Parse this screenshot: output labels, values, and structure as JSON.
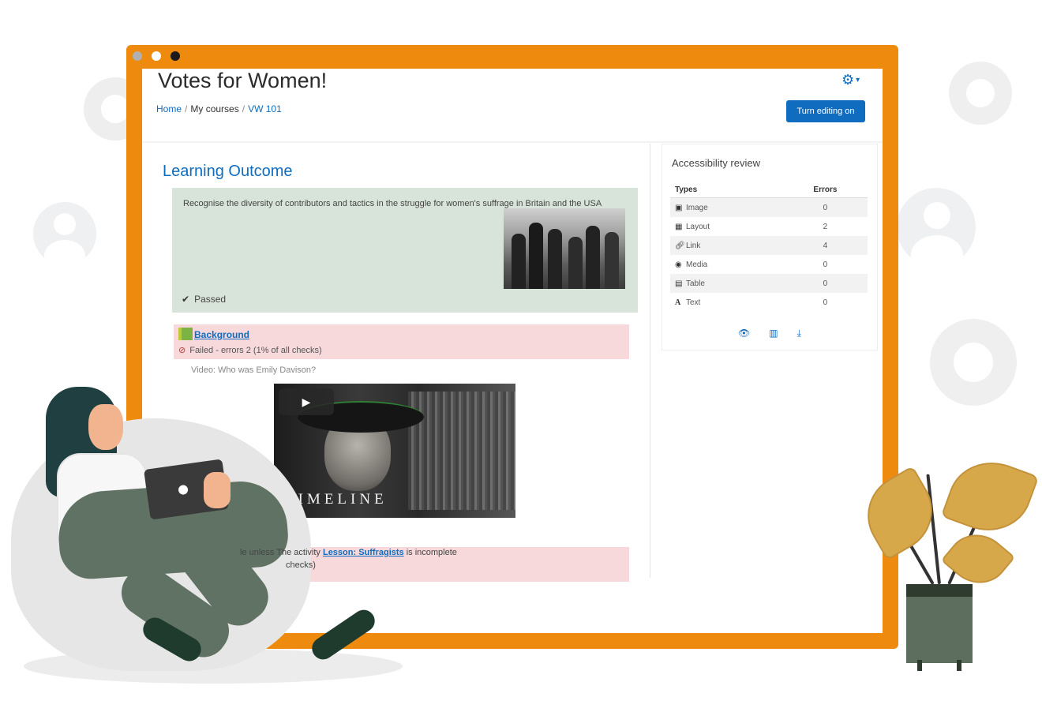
{
  "course": {
    "title": "Votes for Women!",
    "breadcrumb": [
      "Home",
      "My courses",
      "VW 101"
    ],
    "edit_button": "Turn editing on"
  },
  "learning_outcome": {
    "heading": "Learning Outcome",
    "description": "Recognise the diversity of contributors and tactics in the struggle for women's suffrage in Britain and the USA",
    "status": "Passed"
  },
  "activity": {
    "name": "Background",
    "status": "Failed - errors 2 (1% of all checks)",
    "video_caption": "Video: Who was Emily Davison?",
    "video_overlay": "TIMELINE"
  },
  "restriction": {
    "text_prefix": "le unless The activity",
    "link": "Lesson: Suffragists",
    "text_suffix": "is incomplete",
    "checked": "checks)"
  },
  "accessibility_review": {
    "title": "Accessibility review",
    "columns": [
      "Types",
      "Errors"
    ],
    "rows": [
      {
        "type": "Image",
        "errors": "0",
        "icon": "image-icon"
      },
      {
        "type": "Layout",
        "errors": "2",
        "icon": "layout-icon"
      },
      {
        "type": "Link",
        "errors": "4",
        "icon": "link-icon"
      },
      {
        "type": "Media",
        "errors": "0",
        "icon": "media-icon"
      },
      {
        "type": "Table",
        "errors": "0",
        "icon": "table-icon"
      },
      {
        "type": "Text",
        "errors": "0",
        "icon": "text-icon"
      }
    ],
    "actions": [
      "show-heatmap-icon",
      "report-chart-icon",
      "download-icon"
    ]
  },
  "colors": {
    "accent": "#0f6cbf",
    "window_frame": "#ee8a0e",
    "passed_bg": "#d8e4d9",
    "failed_bg": "#f7d9dc"
  },
  "window_dots": [
    "#b0b0b0",
    "#ffffff",
    "#1b1b1b"
  ]
}
